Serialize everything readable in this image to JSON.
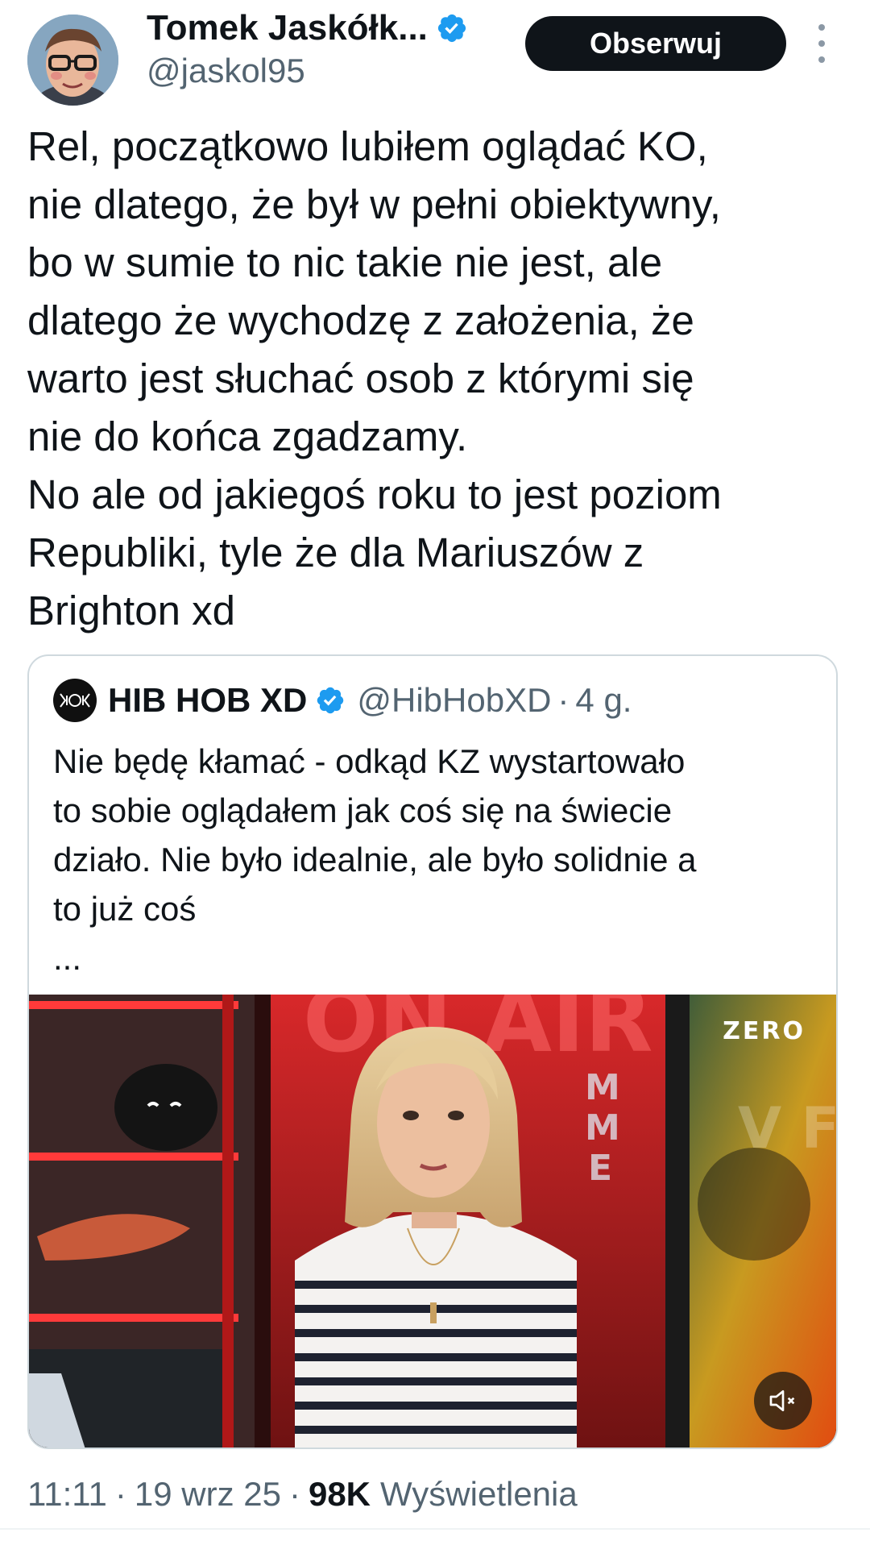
{
  "author": {
    "name": "Tomek Jaskółk...",
    "handle": "@jaskol95",
    "verified": true,
    "follow_label": "Obserwuj"
  },
  "tweet": {
    "lines": [
      "Rel, początkowo lubiłem oglądać KO,",
      "nie dlatego, że był w pełni obiektywny,",
      "bo w sumie to nic takie nie jest, ale",
      "dlatego że wychodzę z założenia, że",
      "warto jest słuchać osob z którymi się",
      "nie do końca zgadzamy.",
      "No ale od jakiegoś roku to jest poziom",
      "Republiki, tyle że dla Mariuszów z",
      "Brighton xd"
    ]
  },
  "quoted_tweet": {
    "name": "HIB HOB XD",
    "handle": "@HibHobXD",
    "separator": "·",
    "time": "4 g.",
    "verified": true,
    "lines": [
      "Nie będę kłamać - odkąd KZ wystartowało",
      "to sobie oglądałem jak coś się na świecie",
      "działo. Nie było idealnie, ale było solidnie a",
      "to już coś",
      "..."
    ],
    "media": {
      "channel_logo": "ZERO",
      "mute_icon": "speaker-muted-icon"
    }
  },
  "meta": {
    "time": "11:11",
    "separator": "·",
    "date": "19 wrz 25",
    "views_count": "98K",
    "views_label": "Wyświetlenia"
  },
  "colors": {
    "verified": "#1d9bf0",
    "secondary_text": "#536471",
    "primary_text": "#0f1419",
    "button_bg": "#0f1419",
    "border": "#cfd9de"
  }
}
